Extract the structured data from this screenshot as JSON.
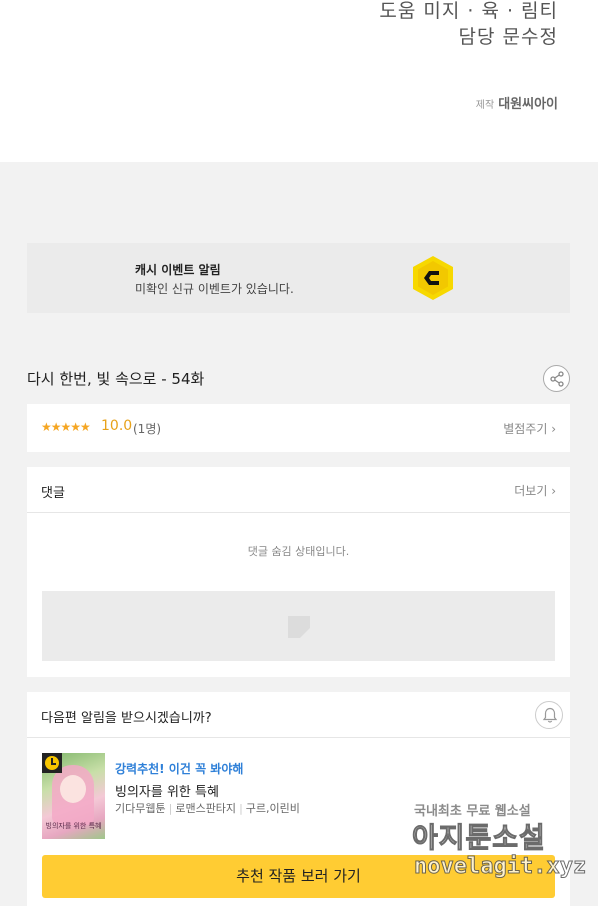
{
  "credits": {
    "line1": "도움 미지 · 육 · 림티",
    "line2": "담당 문수정",
    "producer_label": "제작",
    "producer_name": "대원씨아이"
  },
  "cash_event": {
    "title": "캐시 이벤트 알림",
    "description": "미확인 신규 이벤트가 있습니다.",
    "icon": "c-coin-icon",
    "icon_color": "#f7d800"
  },
  "episode": {
    "title": "다시 한번, 빛 속으로 - 54화",
    "share_icon": "share-icon"
  },
  "rating": {
    "stars": "★★★★★",
    "score": "10.0",
    "count": "(1명)",
    "rate_label": "별점주기 ›",
    "star_color": "#f5a623"
  },
  "comments": {
    "title": "댓글",
    "more_label": "더보기 ›",
    "hidden_message": "댓글 숨김 상태입니다."
  },
  "next_episode": {
    "question": "다음편 알림을 받으시겠습니까?",
    "bell_icon": "bell-icon",
    "recommend": {
      "tag": "강력추천! 이건 꼭 봐야해",
      "name": "빙의자를 위한 특혜",
      "genre1": "기다무웹툰",
      "genre2": "로맨스판타지",
      "authors": "구르,이린비",
      "thumb_title": "빙의자를 위한 특혜"
    },
    "go_button": "추천 작품 보러 가기",
    "accent": "#ffcc33"
  },
  "watermark": {
    "line1": "국내최초 무료 웹소설",
    "line2": "아지툰소설",
    "line3": "novelagit.xyz"
  }
}
